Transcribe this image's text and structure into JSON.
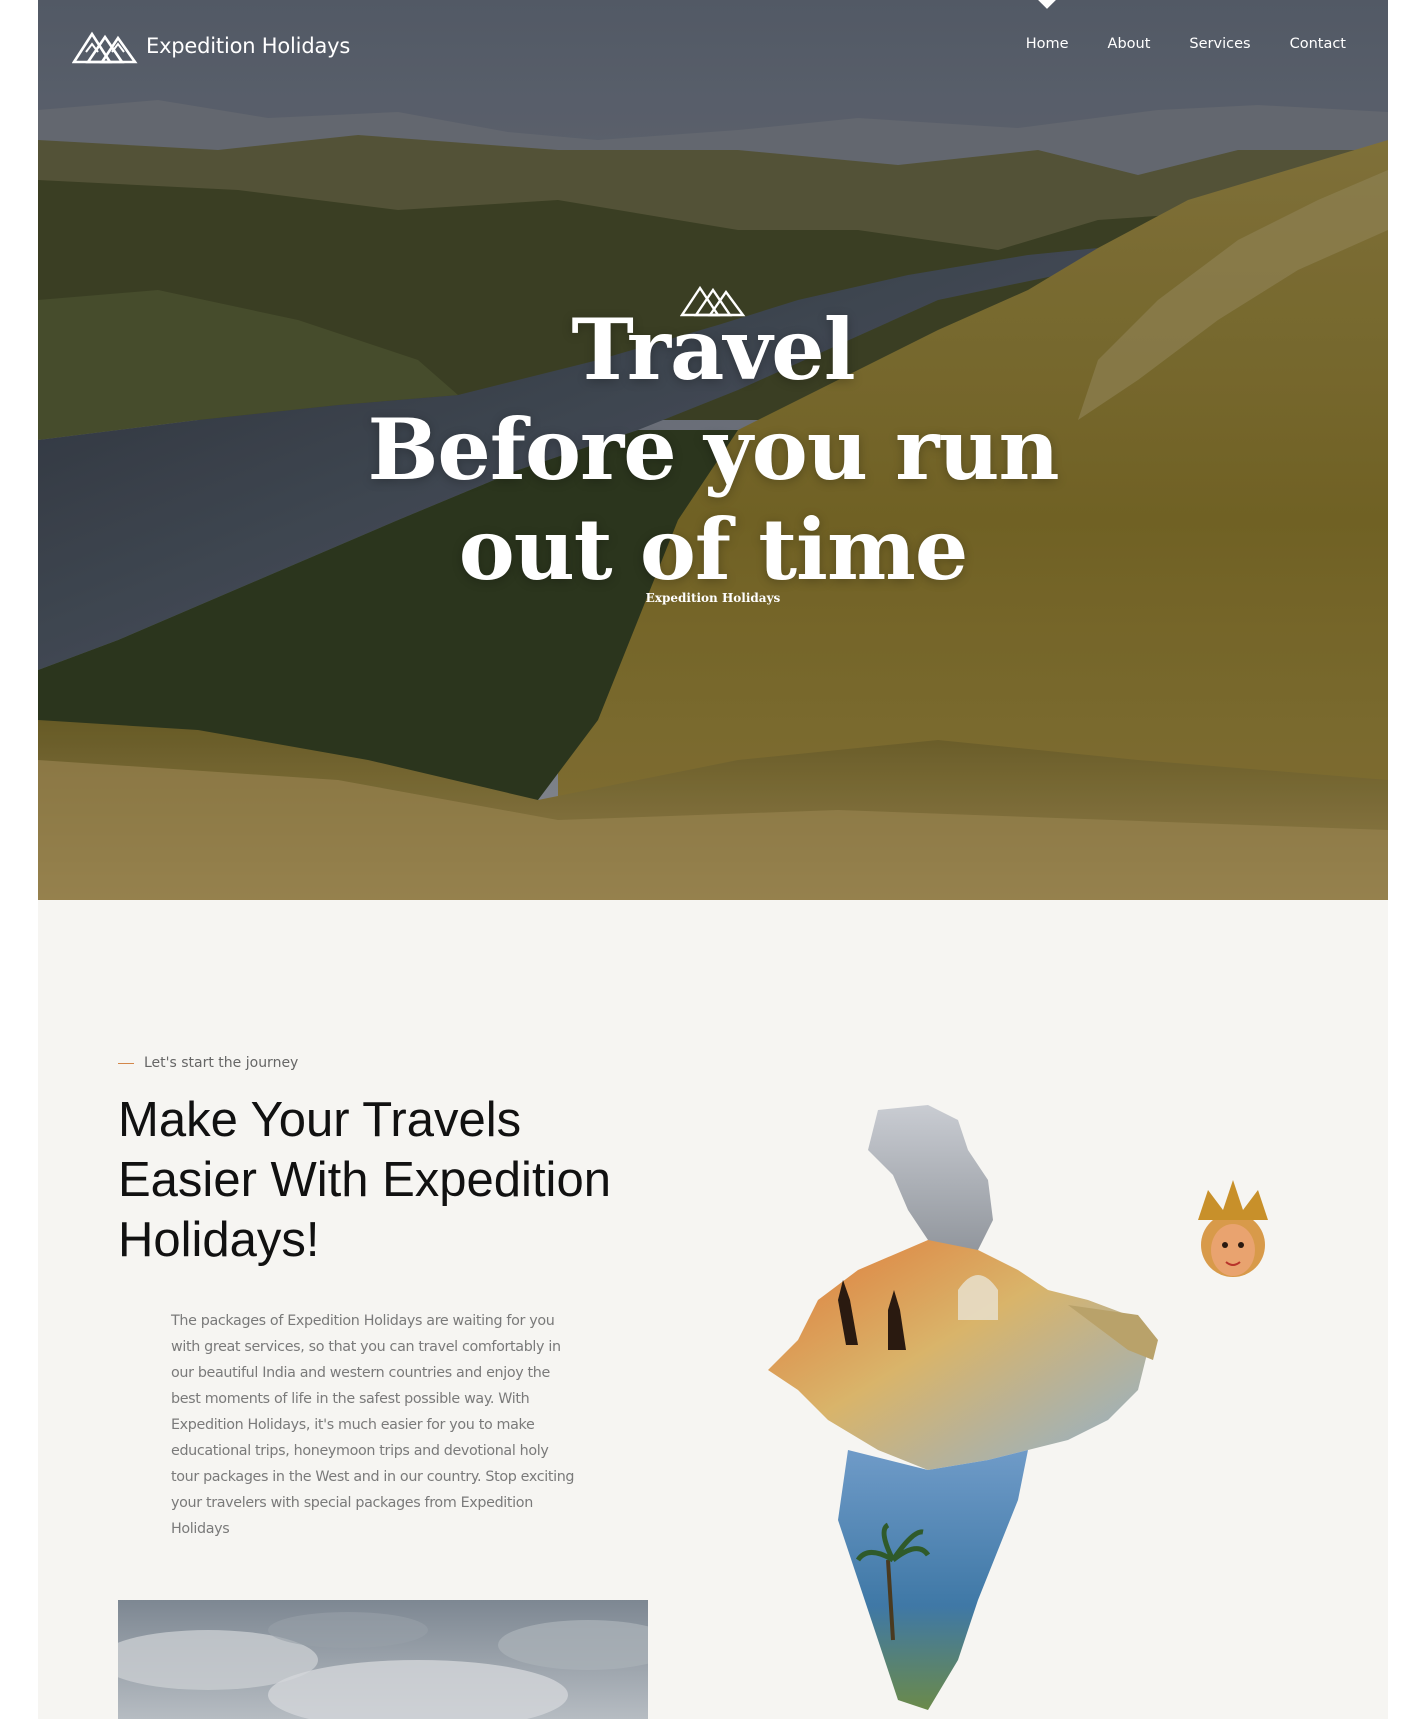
{
  "brand": {
    "name": "Expedition Holidays",
    "logo_icon": "mountains-logo-icon"
  },
  "nav": {
    "items": [
      {
        "label": "Home",
        "active": true
      },
      {
        "label": "About",
        "active": false
      },
      {
        "label": "Services",
        "active": false
      },
      {
        "label": "Contact",
        "active": false
      }
    ]
  },
  "hero": {
    "title_lines": [
      "Travel",
      "Before you run",
      "out of time"
    ],
    "subtitle": "Expedition Holidays",
    "mark_icon": "mountains-mark-icon"
  },
  "about": {
    "eyebrow": "Let's start the journey",
    "title_lines": [
      "Make Your Travels",
      "Easier With Expedition",
      "Holidays!"
    ],
    "body": "The packages of Expedition Holidays are waiting for you with great services, so that you can travel comfortably in our beautiful India and western countries and enjoy the best moments of life in the safest possible way. With Expedition Holidays, it's much easier for you to make educational trips, honeymoon trips and devotional holy tour packages in the West and in our country. Stop exciting your travelers with special packages from Expedition Holidays"
  },
  "colors": {
    "accent": "#d3874a",
    "page_bg": "#f6f5f2",
    "heading": "#111111",
    "body_text": "#7a7a7a"
  }
}
